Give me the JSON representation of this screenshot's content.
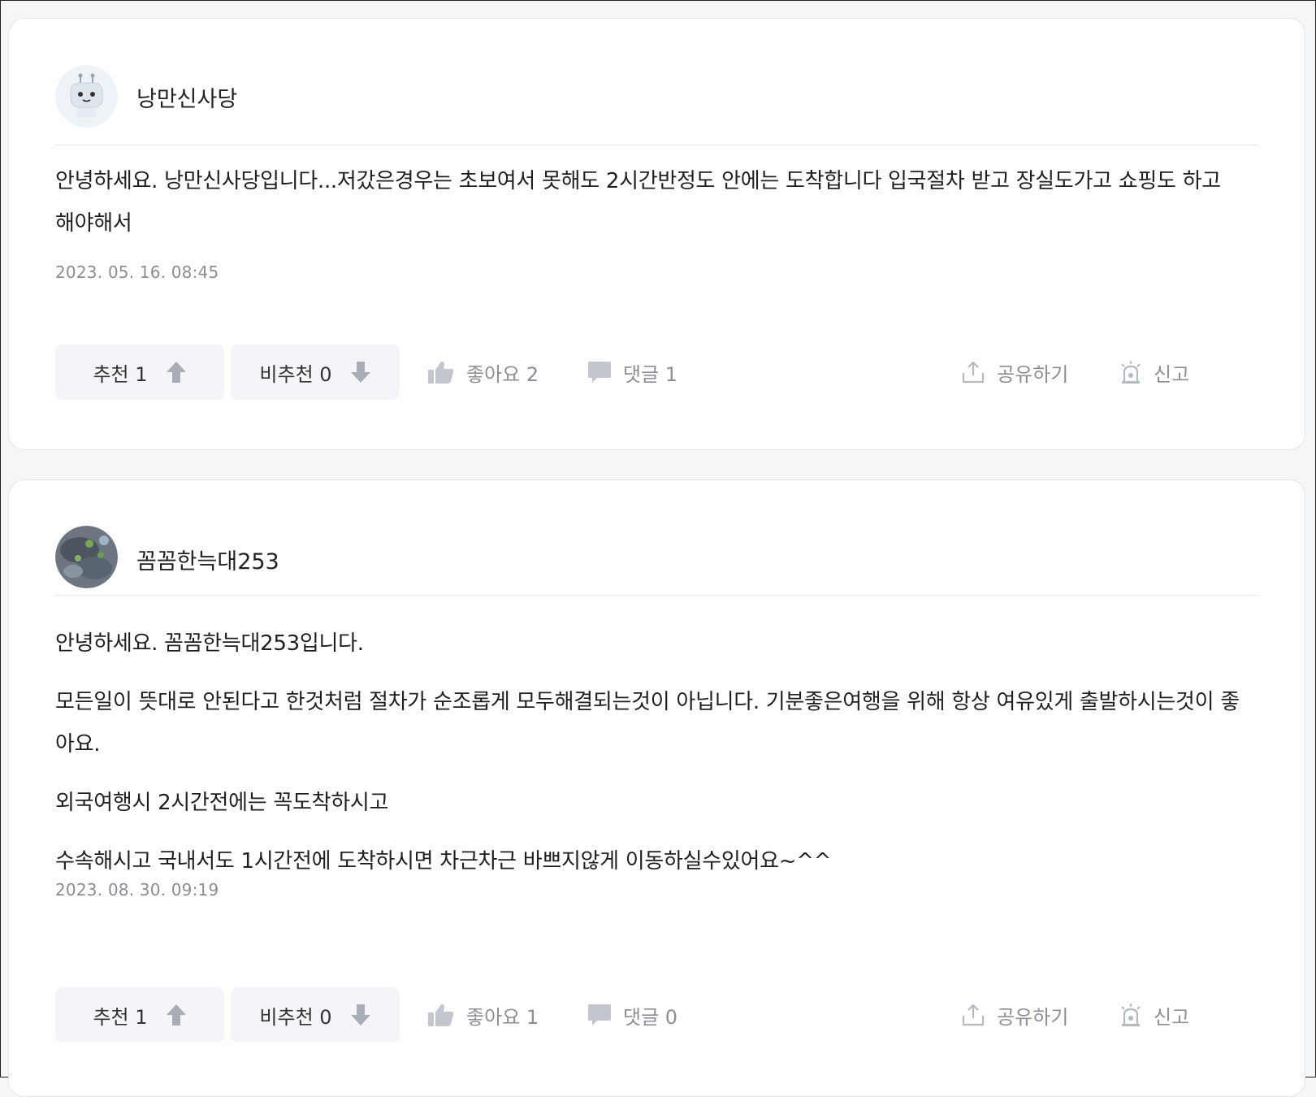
{
  "answers": [
    {
      "author": "낭만신사당",
      "paragraphs": [
        "안녕하세요. 낭만신사당입니다...저갔은경우는 초보여서 못해도 2시간반정도 안에는 도착합니다 입국절차 받고 장실도가고 쇼핑도 하고 해야해서"
      ],
      "date": "2023. 05. 16. 08:45",
      "recommend": "추천 1",
      "not_recommend": "비추천 0",
      "like": "좋아요 2",
      "comment": "댓글 1",
      "share": "공유하기",
      "report": "신고"
    },
    {
      "author": "꼼꼼한늑대253",
      "paragraphs": [
        "안녕하세요. 꼼꼼한늑대253입니다.",
        "모든일이 뜻대로 안된다고 한것처럼 절차가 순조롭게 모두해결되는것이 아닙니다. 기분좋은여행을 위해 항상 여유있게 출발하시는것이 좋아요.",
        "외국여행시 2시간전에는 꼭도착하시고",
        "수속해시고 국내서도 1시간전에 도착하시면 차근차근 바쁘지않게 이동하실수있어요~^^"
      ],
      "date": "2023. 08. 30. 09:19",
      "recommend": "추천 1",
      "not_recommend": "비추천 0",
      "like": "좋아요 1",
      "comment": "댓글 0",
      "share": "공유하기",
      "report": "신고"
    }
  ],
  "icons": {
    "up": "arrow-up-icon",
    "down": "arrow-down-icon",
    "like": "thumbs-up-icon",
    "comment": "speech-bubble-icon",
    "share": "share-upload-icon",
    "report": "siren-icon"
  },
  "colors": {
    "icon_gray": "#b5b9c0",
    "button_bg": "#f3f5f8",
    "date_gray": "#8a8d93"
  }
}
